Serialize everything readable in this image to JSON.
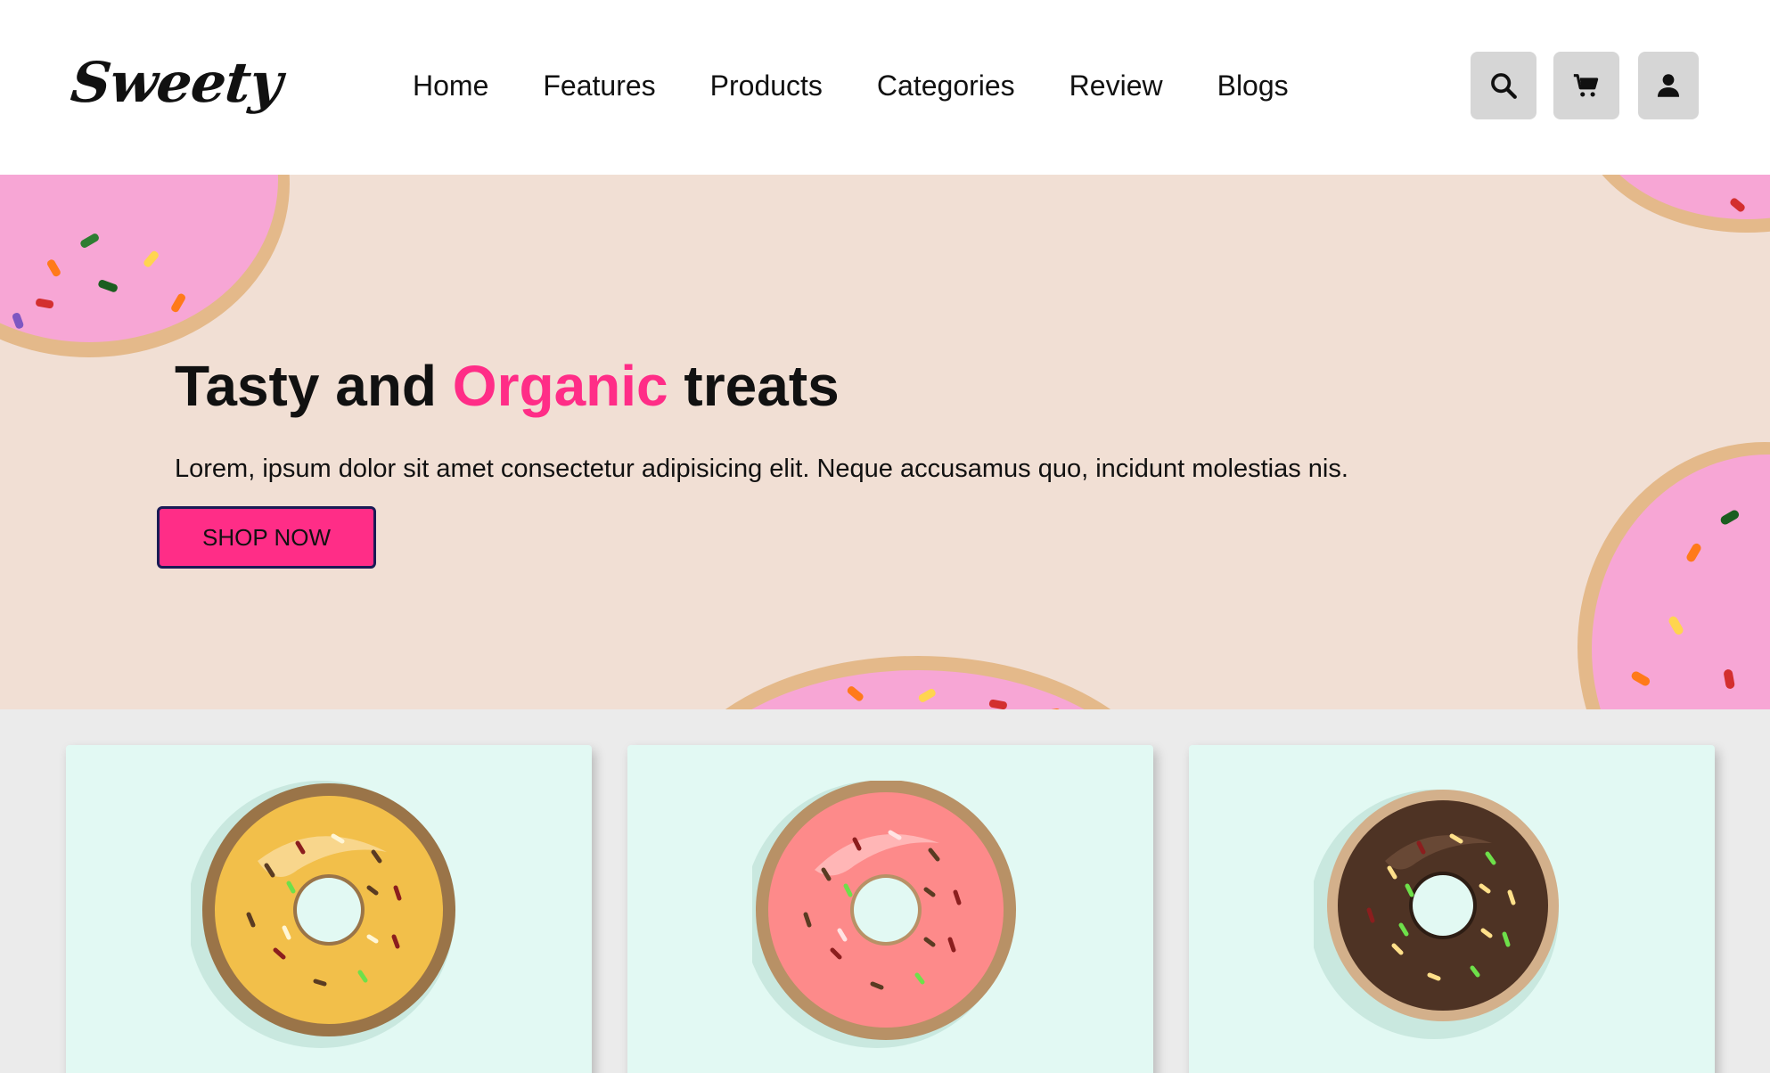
{
  "brand": {
    "logo": "Sweety"
  },
  "nav": {
    "items": [
      "Home",
      "Features",
      "Products",
      "Categories",
      "Review",
      "Blogs"
    ]
  },
  "header_icons": [
    "search-icon",
    "cart-icon",
    "user-icon"
  ],
  "hero": {
    "title_part1": "Tasty and ",
    "title_accent": "Organic",
    "title_part2": " treats",
    "text": "Lorem, ipsum dolor sit amet consectetur adipisicing elit. Neque accusamus quo, incidunt molestias nis.",
    "button_label": "SHOP NOW"
  },
  "products": [
    {
      "image": "donut-yellow-glaze-icon"
    },
    {
      "image": "donut-pink-glaze-icon"
    },
    {
      "image": "donut-chocolate-glaze-icon"
    }
  ],
  "colors": {
    "accent": "#ff2d87",
    "hero_bg": "#f1dfd4",
    "card_bg": "#e2f9f3",
    "icon_button_bg": "#d6d6d6"
  }
}
